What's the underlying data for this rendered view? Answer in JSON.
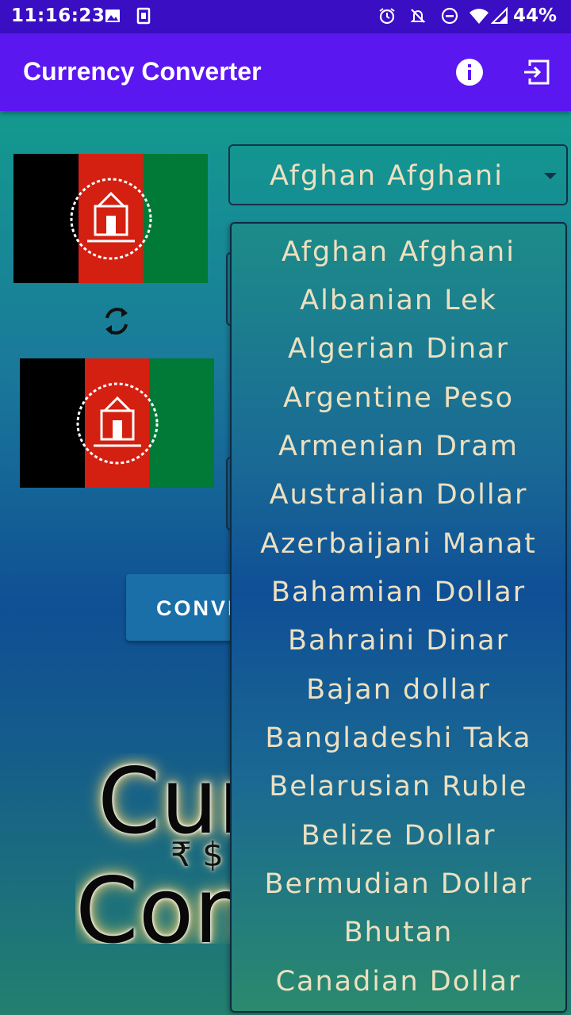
{
  "status_bar": {
    "time": "11:16:23",
    "battery": "44%",
    "icons": [
      "image-icon",
      "sim-icon",
      "alarm-icon",
      "mute-icon",
      "dnd-icon",
      "wifi-icon",
      "signal-icon"
    ]
  },
  "app_bar": {
    "title": "Currency Converter",
    "icons": [
      "info-icon",
      "exit-icon"
    ]
  },
  "converter": {
    "from_currency": "Afghan Afghani",
    "to_flag": "afghanistan-flag",
    "convert_label": "CONVERT"
  },
  "dropdown": {
    "items": [
      "Afghan Afghani",
      "Albanian Lek",
      "Algerian Dinar",
      "Argentine Peso",
      "Armenian Dram",
      "Australian Dollar",
      "Azerbaijani Manat",
      "Bahamian Dollar",
      "Bahraini Dinar",
      "Bajan dollar",
      "Bangladeshi Taka",
      "Belarusian Ruble",
      "Belize Dollar",
      "Bermudian Dollar",
      "Bhutan",
      "Canadian Dollar"
    ]
  },
  "logo": {
    "line1": "Currency",
    "symbols": "₹ $",
    "line2": "Converter"
  },
  "colors": {
    "status_bar": "#3a0fc4",
    "app_bar": "#5a17f0",
    "text_cream": "#ece0c0",
    "button": "#1a6fa8"
  }
}
